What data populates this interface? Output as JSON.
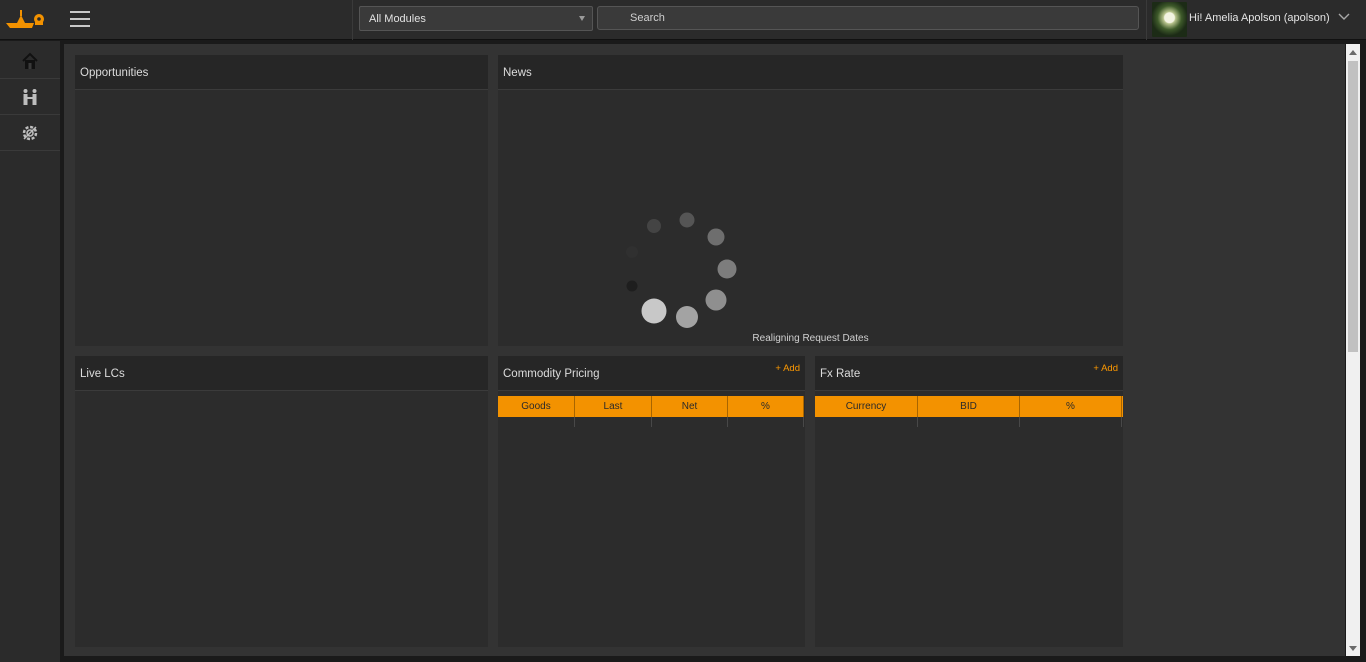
{
  "header": {
    "module_select_value": "All Modules",
    "search_placeholder": "Search",
    "greeting": "Hi! Amelia Apolson (apolson)"
  },
  "sidebar": {
    "items": [
      {
        "icon": "home-icon"
      },
      {
        "icon": "people-icon"
      },
      {
        "icon": "settings-icon"
      }
    ]
  },
  "panels": {
    "opportunities": {
      "title": "Opportunities"
    },
    "news": {
      "title": "News",
      "loading_text": "Realigning Request Dates"
    },
    "live_lcs": {
      "title": "Live LCs"
    },
    "commodity_pricing": {
      "title": "Commodity Pricing",
      "add_label": "+ Add",
      "columns": [
        "Goods",
        "Last",
        "Net",
        "%"
      ]
    },
    "fx_rate": {
      "title": "Fx Rate",
      "add_label": "+ Add",
      "columns": [
        "Currency",
        "BID",
        "%"
      ]
    }
  },
  "colors": {
    "accent": "#f39200",
    "link": "#ff9a00",
    "panel_bg": "#2c2c2c",
    "page_bg": "#333333"
  }
}
